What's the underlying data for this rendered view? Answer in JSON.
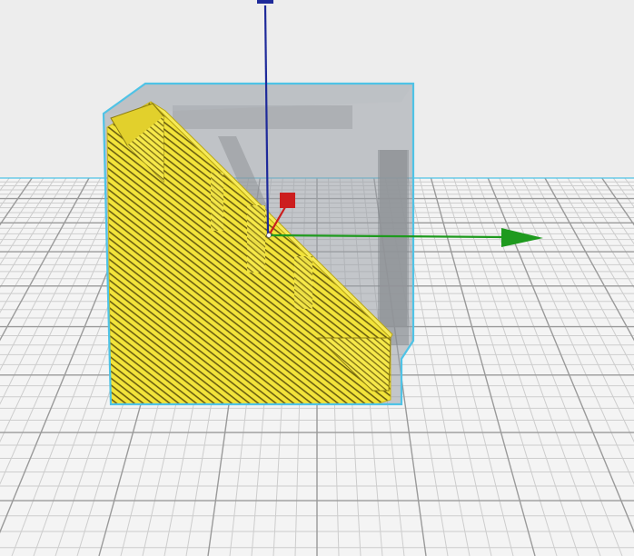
{
  "viewport": {
    "background_color": "#ededed",
    "build_plate_color": "#f4f4f4",
    "grid_major_color": "#9a9a9a",
    "grid_minor_color": "#cdcdcd"
  },
  "model": {
    "fill_color": "#f2e33a",
    "layer_line_color": "#6b5f10",
    "selection_outline_color": "#4fc3e6",
    "bounding_volume_color": "#9aa0a8",
    "shadow_color": "#a6a6a6"
  },
  "gizmo": {
    "x_axis": {
      "name": "x-axis-arrow",
      "color": "#1e9a1e"
    },
    "y_axis": {
      "name": "y-axis-handle",
      "color": "#cc1e1e"
    },
    "z_axis": {
      "name": "z-axis-arrow",
      "color": "#1e2a9a"
    }
  }
}
